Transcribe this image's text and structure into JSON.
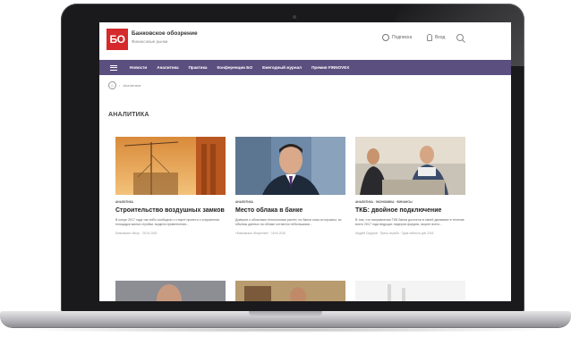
{
  "site": {
    "logo_text": "БО",
    "title": "Банковское обозрение",
    "subtitle": "Финансовые рынки",
    "subscribe_label": "Подписка",
    "login_label": "Вход",
    "brand_color": "#d5292b",
    "nav_color": "#5b4f80"
  },
  "nav": {
    "items": [
      "Новости",
      "Аналитика",
      "Практика",
      "Конференции БО",
      "Ежегодный журнал",
      "Премия FINNOVEX"
    ]
  },
  "breadcrumb": {
    "current": "Аналитика"
  },
  "page": {
    "title": "АНАЛИТИКА"
  },
  "cards": [
    {
      "category": "АНАЛИТИКА",
      "headline": "Строительство воздушных замков",
      "excerpt": "В конце 2017 года так либо сообщали о старте проекта о сохранении площадки жилья стройки, модели привлечения...",
      "meta": "Банковское обозр. · 25.04.2018"
    },
    {
      "category": "АНАЛИТИКА",
      "headline": "Место облака в банке",
      "excerpt": "Доверие к облачным технологиям растет, но банки пока осторожны: их объемы данных на облаке остаются небольшими...",
      "meta": "«Банковское обозрение» · 18.04.2018"
    },
    {
      "category": "АНАЛИТИКА · ЭКОНОМИКА · ФИНАНСЫ",
      "headline": "ТКБ: двойное подключение",
      "excerpt": "В том, что направления ТКБ банка достигли в своей динамике в течение всего 2017 года ведущих лидеров форума, скорее всего...",
      "meta": "Андрей Сидоров · Пресс-служба · Одна тайна на дне 2018"
    }
  ]
}
